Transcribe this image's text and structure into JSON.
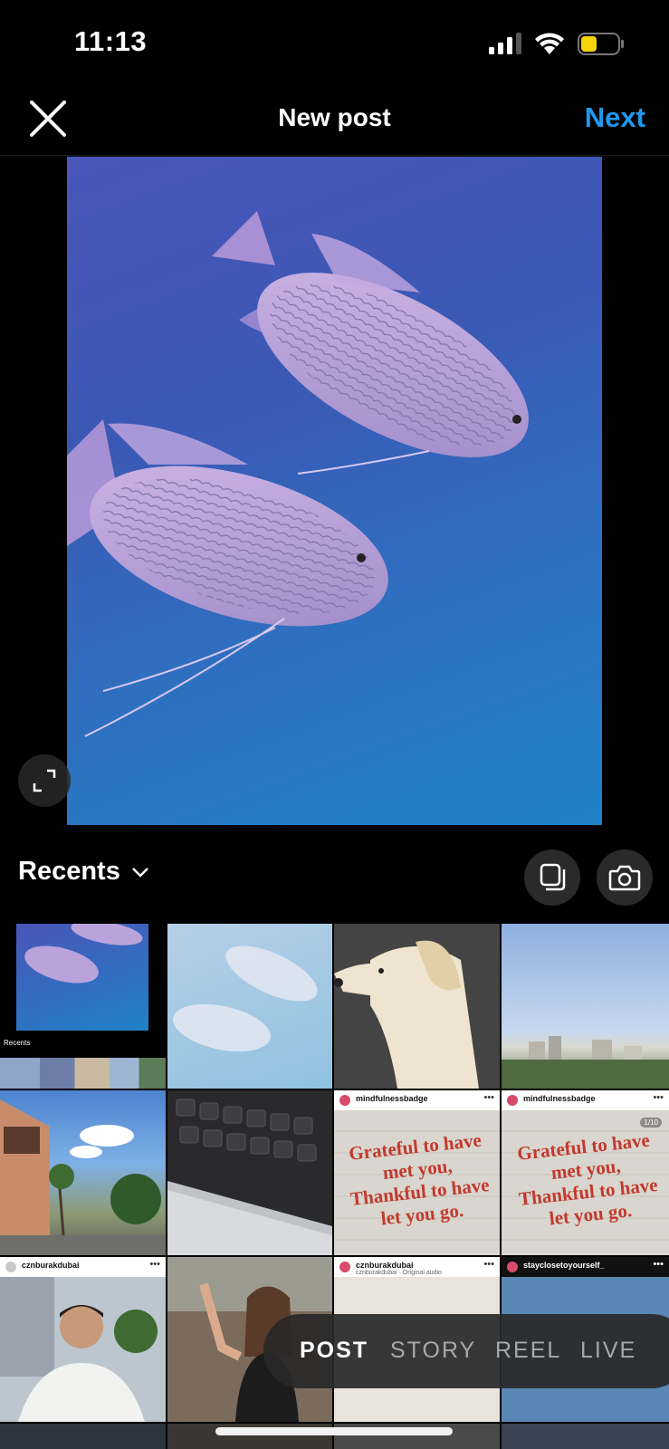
{
  "status_bar": {
    "time": "11:13",
    "battery_color": "#f5d30a"
  },
  "header": {
    "title": "New post",
    "next_label": "Next",
    "accent_color": "#1f98f0"
  },
  "recents": {
    "label": "Recents"
  },
  "grid": {
    "thumb_recents_label": "Recents",
    "tile_quote_user": "mindfulnessbadge",
    "tile_quote_text_line1": "Grateful to have met you,",
    "tile_quote_text_line2": "Thankful to have let you go.",
    "tile_quote_page": "1/10",
    "tile_user_czn": "cznburakdubai",
    "tile_audio": "cznburakdubai · Original audio",
    "tile_user_stay": "stayclosetoyourself_"
  },
  "modes": {
    "items": [
      "POST",
      "STORY",
      "REEL",
      "LIVE"
    ],
    "active": "POST"
  }
}
